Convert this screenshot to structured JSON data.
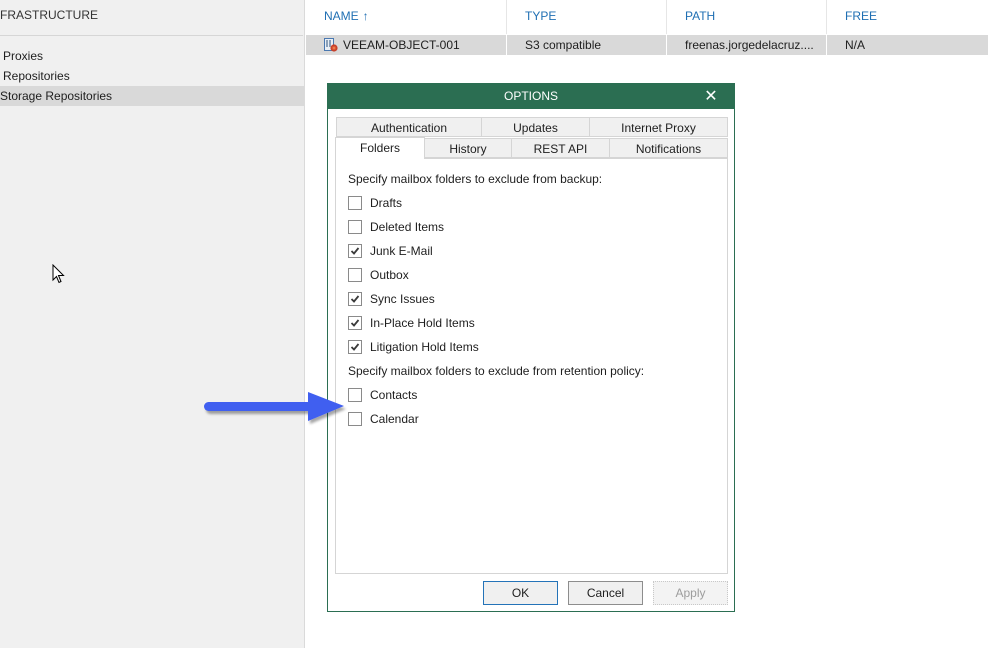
{
  "sidebar": {
    "section_title": "FRASTRUCTURE",
    "items": [
      {
        "label": "Proxies",
        "selected": false
      },
      {
        "label": "Repositories",
        "selected": false
      },
      {
        "label": "Storage Repositories",
        "selected": true
      }
    ]
  },
  "grid": {
    "columns": [
      {
        "label": "NAME",
        "sort": "ascending",
        "sort_icon": "arrow-up-icon"
      },
      {
        "label": "TYPE"
      },
      {
        "label": "PATH"
      },
      {
        "label": "FREE"
      }
    ],
    "rows": [
      {
        "icon": "object-storage-repository-icon",
        "name": "VEEAM-OBJECT-001",
        "type": "S3 compatible",
        "path": "freenas.jorgedelacruz....",
        "free": "N/A",
        "selected": true
      }
    ]
  },
  "dialog": {
    "title": "OPTIONS",
    "close_icon": "close-icon",
    "tabs_row1": [
      {
        "label": "Authentication"
      },
      {
        "label": "Updates"
      },
      {
        "label": "Internet Proxy"
      }
    ],
    "tabs_row2": [
      {
        "label": "Folders",
        "active": true
      },
      {
        "label": "History"
      },
      {
        "label": "REST API"
      },
      {
        "label": "Notifications"
      }
    ],
    "backup_exclusion_label": "Specify mailbox folders to exclude from backup:",
    "backup_exclusions": [
      {
        "label": "Drafts",
        "checked": false
      },
      {
        "label": "Deleted Items",
        "checked": false
      },
      {
        "label": "Junk E-Mail",
        "checked": true
      },
      {
        "label": "Outbox",
        "checked": false
      },
      {
        "label": "Sync Issues",
        "checked": true
      },
      {
        "label": "In-Place Hold Items",
        "checked": true
      },
      {
        "label": "Litigation Hold Items",
        "checked": true
      }
    ],
    "retention_exclusion_label": "Specify mailbox folders to exclude from retention policy:",
    "retention_exclusions": [
      {
        "label": "Contacts",
        "checked": false
      },
      {
        "label": "Calendar",
        "checked": false
      }
    ],
    "buttons": {
      "ok": "OK",
      "cancel": "Cancel",
      "apply": "Apply"
    }
  },
  "colors": {
    "dialog_titlebar": "#2b6e52",
    "column_header_text": "#1f6fb3",
    "annotation_arrow": "#3f5ef0",
    "selection": "#d9d9d9"
  }
}
